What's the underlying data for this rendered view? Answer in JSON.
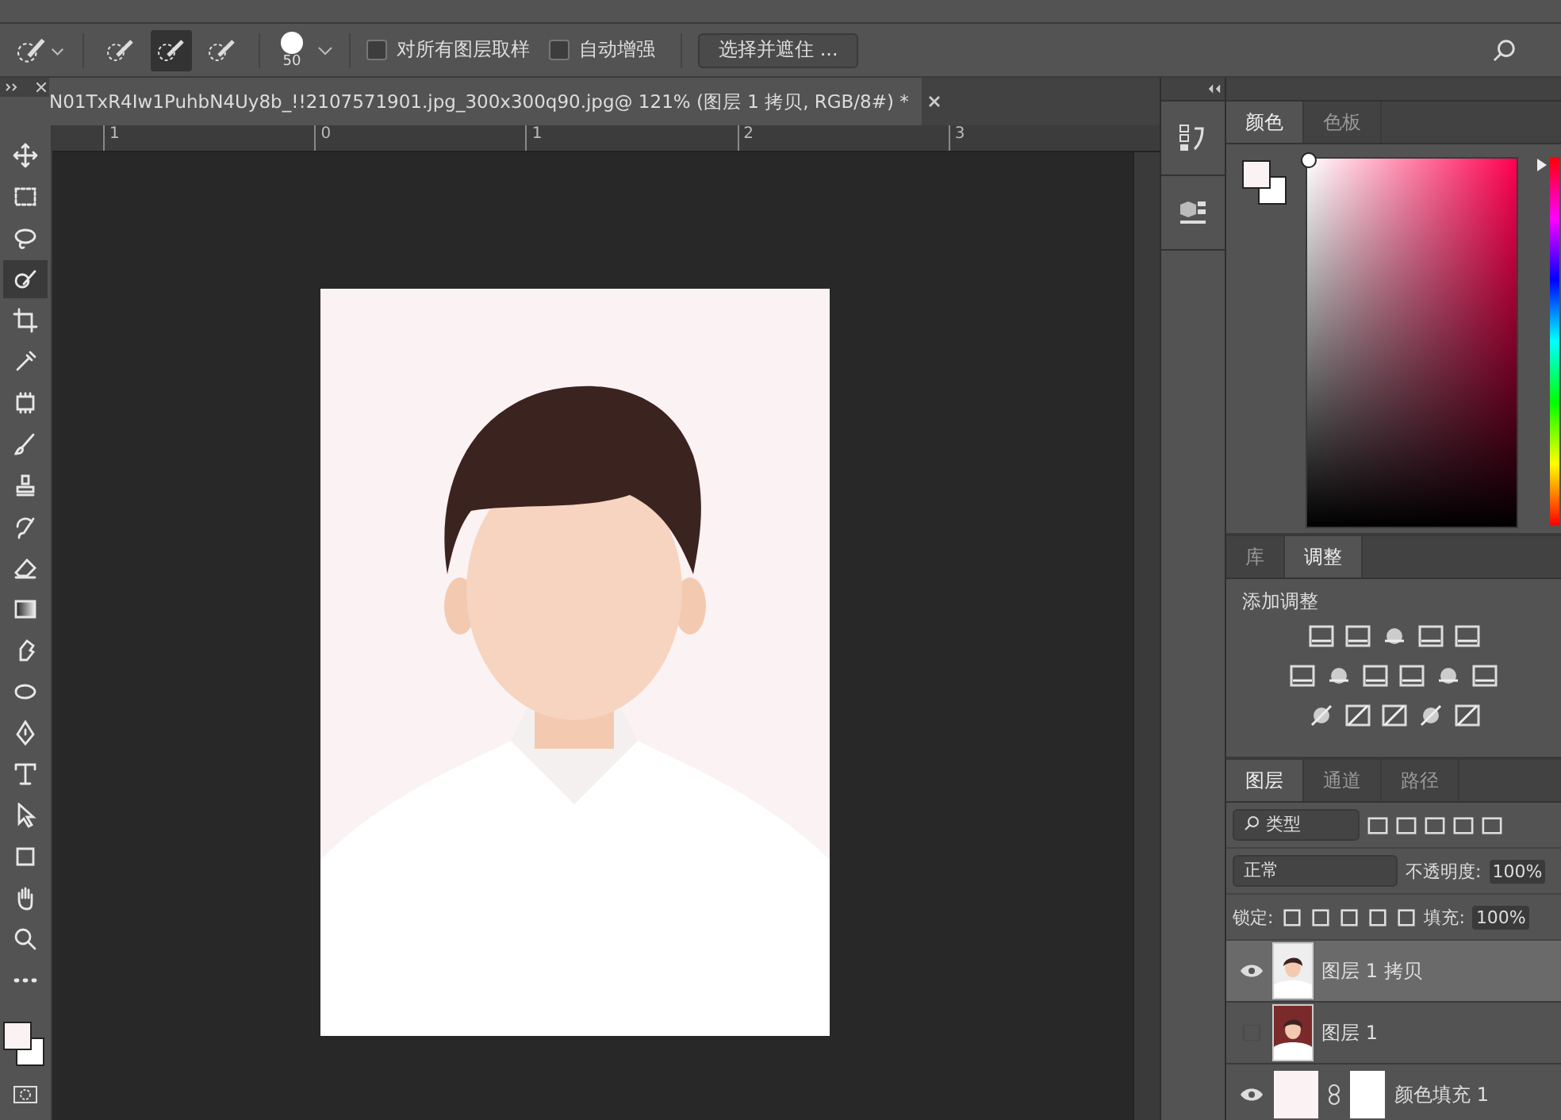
{
  "options_bar": {
    "modes": [
      {
        "selected": false
      },
      {
        "selected": true
      },
      {
        "selected": false
      }
    ],
    "brush_size": "50",
    "sample_all_layers": {
      "label": "对所有图层取样",
      "checked": false
    },
    "auto_enhance": {
      "label": "自动增强",
      "checked": false
    },
    "select_and_mask": "选择并遮住 ..."
  },
  "document_tab": {
    "title": "N01TxR4Iw1PuhbN4Uy8b_!!2107571901.jpg_300x300q90.jpg@ 121% (图层 1 拷贝, RGB/8#) *"
  },
  "ruler": {
    "labels": [
      "1",
      "0",
      "1",
      "2",
      "3"
    ]
  },
  "tools": [
    {
      "kind": "move",
      "selected": false
    },
    {
      "kind": "marquee",
      "selected": false
    },
    {
      "kind": "lasso",
      "selected": false
    },
    {
      "kind": "quick-select",
      "selected": true
    },
    {
      "kind": "crop",
      "selected": false
    },
    {
      "kind": "eyedropper",
      "selected": false
    },
    {
      "kind": "healing",
      "selected": false
    },
    {
      "kind": "brush",
      "selected": false
    },
    {
      "kind": "stamp",
      "selected": false
    },
    {
      "kind": "history-brush",
      "selected": false
    },
    {
      "kind": "eraser",
      "selected": false
    },
    {
      "kind": "gradient",
      "selected": false
    },
    {
      "kind": "smudge",
      "selected": false
    },
    {
      "kind": "dodge",
      "selected": false
    },
    {
      "kind": "pen",
      "selected": false
    },
    {
      "kind": "type",
      "selected": false
    },
    {
      "kind": "path-select",
      "selected": false
    },
    {
      "kind": "shape",
      "selected": false
    },
    {
      "kind": "hand",
      "selected": false
    },
    {
      "kind": "zoom",
      "selected": false
    },
    {
      "kind": "more",
      "selected": false
    }
  ],
  "color_panel": {
    "tabs": [
      {
        "label": "颜色",
        "selected": true
      },
      {
        "label": "色板",
        "selected": false
      }
    ]
  },
  "adjustments_panel": {
    "tabs": [
      {
        "label": "库",
        "selected": false
      },
      {
        "label": "调整",
        "selected": true
      }
    ],
    "heading": "添加调整"
  },
  "layers_panel": {
    "tabs": [
      {
        "label": "图层",
        "selected": true
      },
      {
        "label": "通道",
        "selected": false
      },
      {
        "label": "路径",
        "selected": false
      }
    ],
    "filter": "类型",
    "blend_mode": "正常",
    "opacity_label": "不透明度:",
    "opacity": "100%",
    "lock_label": "锁定:",
    "fill_label": "填充:",
    "fill": "100%",
    "layers": [
      {
        "name": "图层 1 拷贝",
        "visible": true,
        "selected": true
      },
      {
        "name": "图层 1",
        "visible": false,
        "selected": false
      },
      {
        "kind": "fill",
        "name": "颜色填充 1",
        "visible": true,
        "selected": false
      }
    ]
  }
}
